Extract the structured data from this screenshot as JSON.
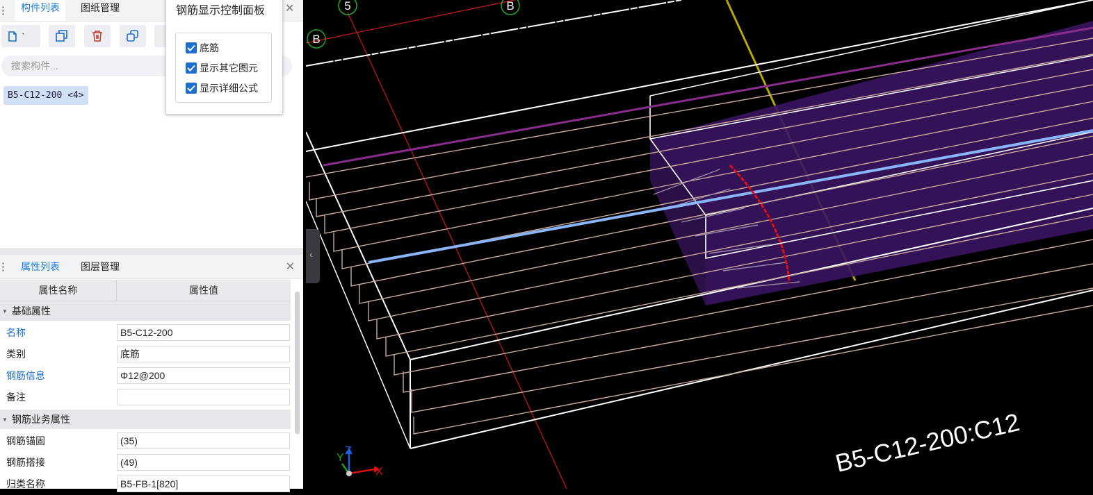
{
  "top_tabs": {
    "tab1": "构件列表",
    "tab2": "图纸管理"
  },
  "toolbar": {
    "new": "new-icon",
    "copy": "copy-icon",
    "delete": "delete-icon",
    "copy2": "copy-layer-icon"
  },
  "search": {
    "placeholder": "搜索构件..."
  },
  "component_list": [
    {
      "label": "B5-C12-200 <4>"
    }
  ],
  "panel": {
    "title": "钢筋显示控制面板",
    "options": [
      {
        "label": "底筋",
        "checked": true
      },
      {
        "label": "显示其它图元",
        "checked": true
      },
      {
        "label": "显示详细公式",
        "checked": true
      }
    ]
  },
  "bottom_tabs": {
    "tab1": "属性列表",
    "tab2": "图层管理"
  },
  "props": {
    "col_name": "属性名称",
    "col_value": "属性值",
    "section1": "基础属性",
    "rows1": [
      {
        "label": "名称",
        "value": "B5-C12-200"
      },
      {
        "label": "类别",
        "value": "底筋"
      },
      {
        "label": "钢筋信息",
        "value": "Φ12@200"
      },
      {
        "label": "备注",
        "value": ""
      }
    ],
    "section2": "钢筋业务属性",
    "rows2": [
      {
        "label": "钢筋锚固",
        "value": "(35)"
      },
      {
        "label": "钢筋搭接",
        "value": "(49)"
      },
      {
        "label": "归类名称",
        "value": "B5-FB-1[820]"
      }
    ]
  },
  "viewport": {
    "axis_labels": [
      "5",
      "B",
      "B"
    ],
    "rebar_tag": "B5-C12-200:C12",
    "axis": {
      "x": "X",
      "y": "Y",
      "z": "Z"
    }
  }
}
